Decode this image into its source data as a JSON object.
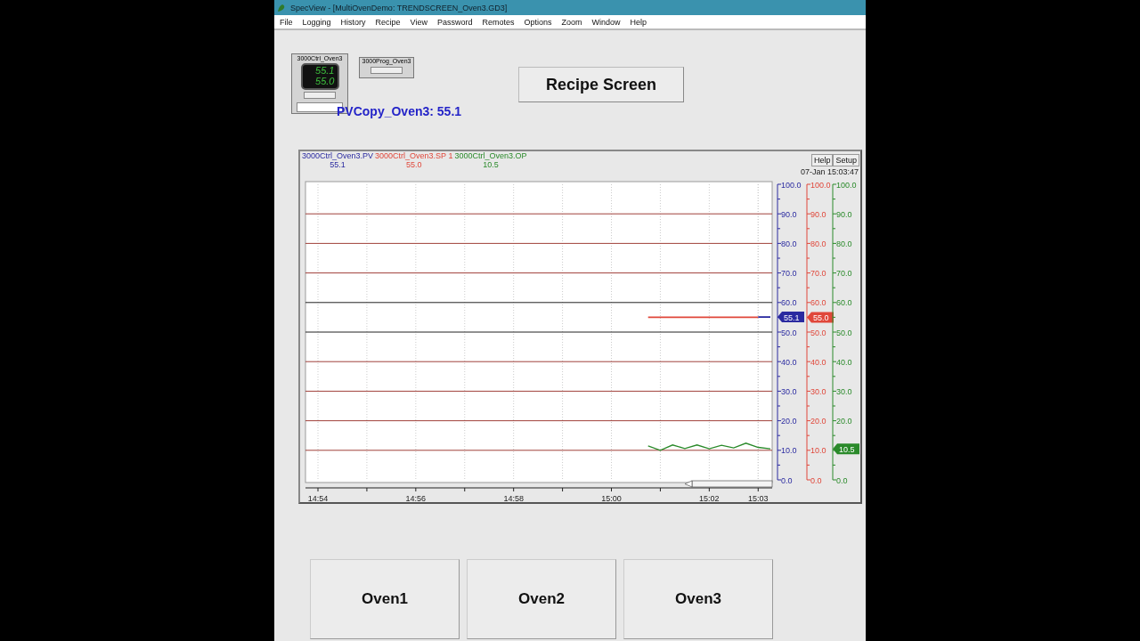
{
  "window": {
    "title": "SpecView - [MultiOvenDemo: TRENDSCREEN_Oven3.GD3]"
  },
  "menu": [
    "File",
    "Logging",
    "History",
    "Recipe",
    "View",
    "Password",
    "Remotes",
    "Options",
    "Zoom",
    "Window",
    "Help"
  ],
  "faceplates": [
    {
      "kind": "controller",
      "title": "3000Ctrl_Oven3",
      "pv": "55.1",
      "sp": "55.0"
    },
    {
      "kind": "programmer",
      "title": "3000Prog_Oven3"
    }
  ],
  "recipe_button": "Recipe Screen",
  "pv_copy": "PVCopy_Oven3: 55.1",
  "trend": {
    "readings": [
      "55.1",
      "55.0",
      "10.5"
    ],
    "buttons": [
      "Help",
      "Setup"
    ],
    "timestamp": "07-Jan 15:03:47",
    "scales": [
      {
        "marker": "55.1"
      },
      {
        "ticks": [
          "100.0",
          "90.0",
          "80.0",
          "70.0",
          "60.0",
          "50.0",
          "40.0",
          "30.0",
          "20.0",
          "10.0",
          "0.0"
        ],
        "marker": "55.0"
      },
      {
        "ticks": [
          "100.0",
          "90.0",
          "80.0",
          "70.0",
          "60.0",
          "50.0",
          "40.0",
          "30.0",
          "20.0",
          "0.0"
        ],
        "marker": "10.5"
      }
    ],
    "chart_data": {
      "type": "line",
      "categories": [
        "14:54",
        null,
        null,
        null,
        null,
        null,
        null,
        null,
        "14:56",
        null,
        null,
        null,
        null,
        null,
        null,
        null,
        "14:58",
        null,
        null,
        null,
        null,
        null,
        null,
        null,
        "15:00",
        null,
        null,
        null,
        null,
        null,
        null,
        null,
        "15:02",
        null,
        null,
        null,
        "15:03",
        null
      ],
      "series": [
        {
          "name": "3000Ctrl_Oven3.PV",
          "color": "#2a2aa0",
          "values": [
            null,
            null,
            null,
            null,
            null,
            null,
            null,
            null,
            null,
            null,
            null,
            null,
            null,
            null,
            null,
            null,
            null,
            null,
            null,
            null,
            null,
            null,
            null,
            null,
            null,
            null,
            null,
            null,
            null,
            null,
            null,
            null,
            null,
            null,
            null,
            null,
            55.1,
            55.1
          ]
        },
        {
          "name": "3000Ctrl_Oven3.SP 1",
          "color": "#e0473a",
          "values": [
            null,
            null,
            null,
            null,
            null,
            null,
            null,
            null,
            null,
            null,
            null,
            null,
            null,
            null,
            null,
            null,
            null,
            null,
            null,
            null,
            null,
            null,
            null,
            null,
            null,
            null,
            null,
            55.0,
            55.0,
            55.0,
            55.0,
            55.0,
            55.0,
            55.0,
            55.0,
            55.0,
            55.0,
            null
          ]
        },
        {
          "name": "3000Ctrl_Oven3.OP",
          "color": "#2a8a2a",
          "values": [
            null,
            null,
            null,
            null,
            null,
            null,
            null,
            null,
            null,
            null,
            null,
            null,
            null,
            null,
            null,
            null,
            null,
            null,
            null,
            null,
            null,
            null,
            null,
            null,
            null,
            null,
            null,
            11.5,
            10.0,
            11.8,
            10.6,
            11.8,
            10.5,
            11.7,
            10.8,
            12.4,
            11.0,
            10.5
          ]
        }
      ],
      "ylim": [
        0,
        100
      ],
      "grid": true,
      "yticks": [
        {
          "value": 100,
          "label": "100.0"
        },
        {
          "value": 90,
          "label": "90.0"
        },
        {
          "value": 80,
          "label": "80.0"
        },
        {
          "value": 70,
          "label": "70.0"
        },
        {
          "value": 60,
          "label": "60.0"
        },
        {
          "value": 50,
          "label": "50.0"
        },
        {
          "value": 40,
          "label": "40.0"
        },
        {
          "value": 30,
          "label": "30.0"
        },
        {
          "value": 20,
          "label": "20.0"
        },
        {
          "value": 10,
          "label": "10.0"
        },
        {
          "value": 0,
          "label": "0.0"
        }
      ]
    }
  },
  "oven_buttons": [
    "Oven1",
    "Oven2",
    "Oven3"
  ]
}
